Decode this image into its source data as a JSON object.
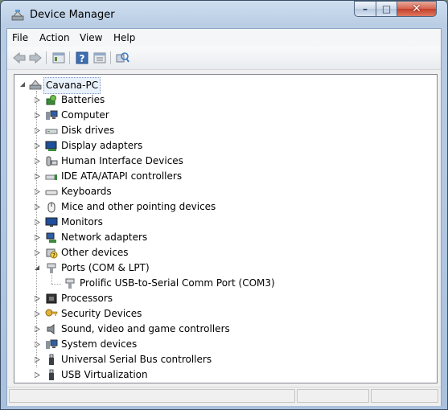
{
  "window": {
    "title": "Device Manager"
  },
  "controls": {
    "minimize": "–",
    "maximize": "□",
    "close": "✕"
  },
  "menu": [
    "File",
    "Action",
    "View",
    "Help"
  ],
  "toolbar": {
    "items": [
      "back-arrow-icon",
      "forward-arrow-icon",
      "properties-icon",
      "help-icon",
      "view-icon",
      "scan-hardware-icon"
    ]
  },
  "tree": {
    "root": "Cavana-PC",
    "nodes": [
      {
        "label": "Batteries",
        "icon": "battery-icon",
        "expanded": false
      },
      {
        "label": "Computer",
        "icon": "computer-icon",
        "expanded": false
      },
      {
        "label": "Disk drives",
        "icon": "disk-drive-icon",
        "expanded": false
      },
      {
        "label": "Display adapters",
        "icon": "display-adapter-icon",
        "expanded": false
      },
      {
        "label": "Human Interface Devices",
        "icon": "hid-icon",
        "expanded": false
      },
      {
        "label": "IDE ATA/ATAPI controllers",
        "icon": "ide-controller-icon",
        "expanded": false
      },
      {
        "label": "Keyboards",
        "icon": "keyboard-icon",
        "expanded": false
      },
      {
        "label": "Mice and other pointing devices",
        "icon": "mouse-icon",
        "expanded": false
      },
      {
        "label": "Monitors",
        "icon": "monitor-icon",
        "expanded": false
      },
      {
        "label": "Network adapters",
        "icon": "network-adapter-icon",
        "expanded": false
      },
      {
        "label": "Other devices",
        "icon": "other-device-icon",
        "expanded": false
      },
      {
        "label": "Ports (COM & LPT)",
        "icon": "port-icon",
        "expanded": true,
        "children": [
          {
            "label": "Prolific USB-to-Serial Comm Port (COM3)",
            "icon": "port-icon"
          }
        ]
      },
      {
        "label": "Processors",
        "icon": "processor-icon",
        "expanded": false
      },
      {
        "label": "Security Devices",
        "icon": "security-key-icon",
        "expanded": false
      },
      {
        "label": "Sound, video and game controllers",
        "icon": "speaker-icon",
        "expanded": false
      },
      {
        "label": "System devices",
        "icon": "system-device-icon",
        "expanded": false
      },
      {
        "label": "Universal Serial Bus controllers",
        "icon": "usb-plug-icon",
        "expanded": false
      },
      {
        "label": "USB Virtualization",
        "icon": "usb-plug-icon",
        "expanded": false
      }
    ]
  }
}
